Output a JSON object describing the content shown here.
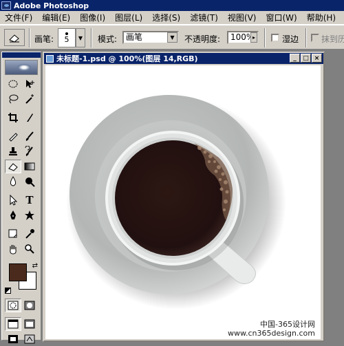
{
  "app": {
    "title": "Adobe Photoshop"
  },
  "menu": [
    "文件(F)",
    "编辑(E)",
    "图像(I)",
    "图层(L)",
    "选择(S)",
    "滤镜(T)",
    "视图(V)",
    "窗口(W)",
    "帮助(H)"
  ],
  "options": {
    "brush_label": "画笔:",
    "brush_size": "5",
    "mode_label": "模式:",
    "mode_value": "画笔",
    "opacity_label": "不透明度:",
    "opacity_value": "100%",
    "wet_edges_label": "湿边",
    "erase_history_label": "抹到历"
  },
  "document": {
    "title": "未标题-1.psd @ 100%(图层 14,RGB)",
    "watermark_line1": "中国-365设计网",
    "watermark_line2": "www.cn365design.com"
  },
  "colors": {
    "foreground": "#4a2a1c",
    "background": "#ffffff",
    "titlebar": "#0a246a",
    "chrome": "#d4d0c8"
  },
  "tools": {
    "active": "eraser-tool"
  }
}
